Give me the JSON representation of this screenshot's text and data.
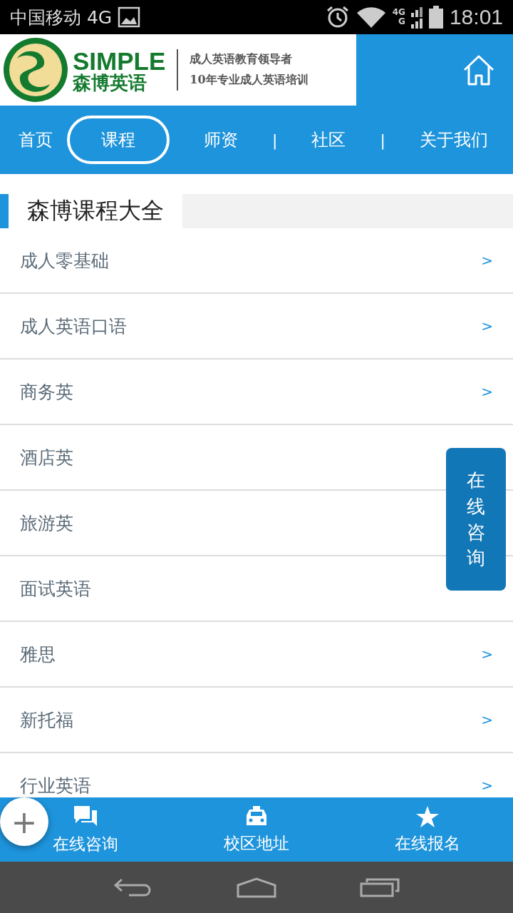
{
  "status_bar": {
    "carrier": "中国移动 4G",
    "network": "4G",
    "network_2": "G",
    "time": "18:01"
  },
  "header": {
    "logo_text": "SIMPLE",
    "logo_subtitle": "森博英语",
    "tagline": [
      "成人英语教育领导者",
      "10年专业成人英语培训"
    ]
  },
  "nav": [
    {
      "kind": "link",
      "label": "首页",
      "selected": false
    },
    {
      "kind": "link",
      "label": "课程",
      "selected": true
    },
    {
      "kind": "link",
      "label": "师资",
      "selected": false
    },
    {
      "kind": "divider",
      "label": "|"
    },
    {
      "kind": "link",
      "label": "社区",
      "selected": false
    },
    {
      "kind": "divider",
      "label": "|"
    },
    {
      "kind": "link",
      "label": "关于我们",
      "selected": false
    }
  ],
  "section_title": "森博课程大全",
  "courses": [
    {
      "label": "成人零基础",
      "arrow": ">"
    },
    {
      "label": "成人英语口语",
      "arrow": ">"
    },
    {
      "label": "商务英",
      "arrow": ">"
    },
    {
      "label": "酒店英"
    },
    {
      "label": "旅游英"
    },
    {
      "label": "面试英语"
    },
    {
      "label": "雅思",
      "arrow": ">"
    },
    {
      "label": "新托福",
      "arrow": ">"
    },
    {
      "label": "行业英语",
      "arrow": ">"
    }
  ],
  "float_button": "在线咨询",
  "bottom_bar": [
    {
      "kind": "chat",
      "label": "在线咨询"
    },
    {
      "kind": "car",
      "label": "校区地址"
    },
    {
      "kind": "star",
      "label": "在线报名"
    }
  ],
  "fab": "+"
}
